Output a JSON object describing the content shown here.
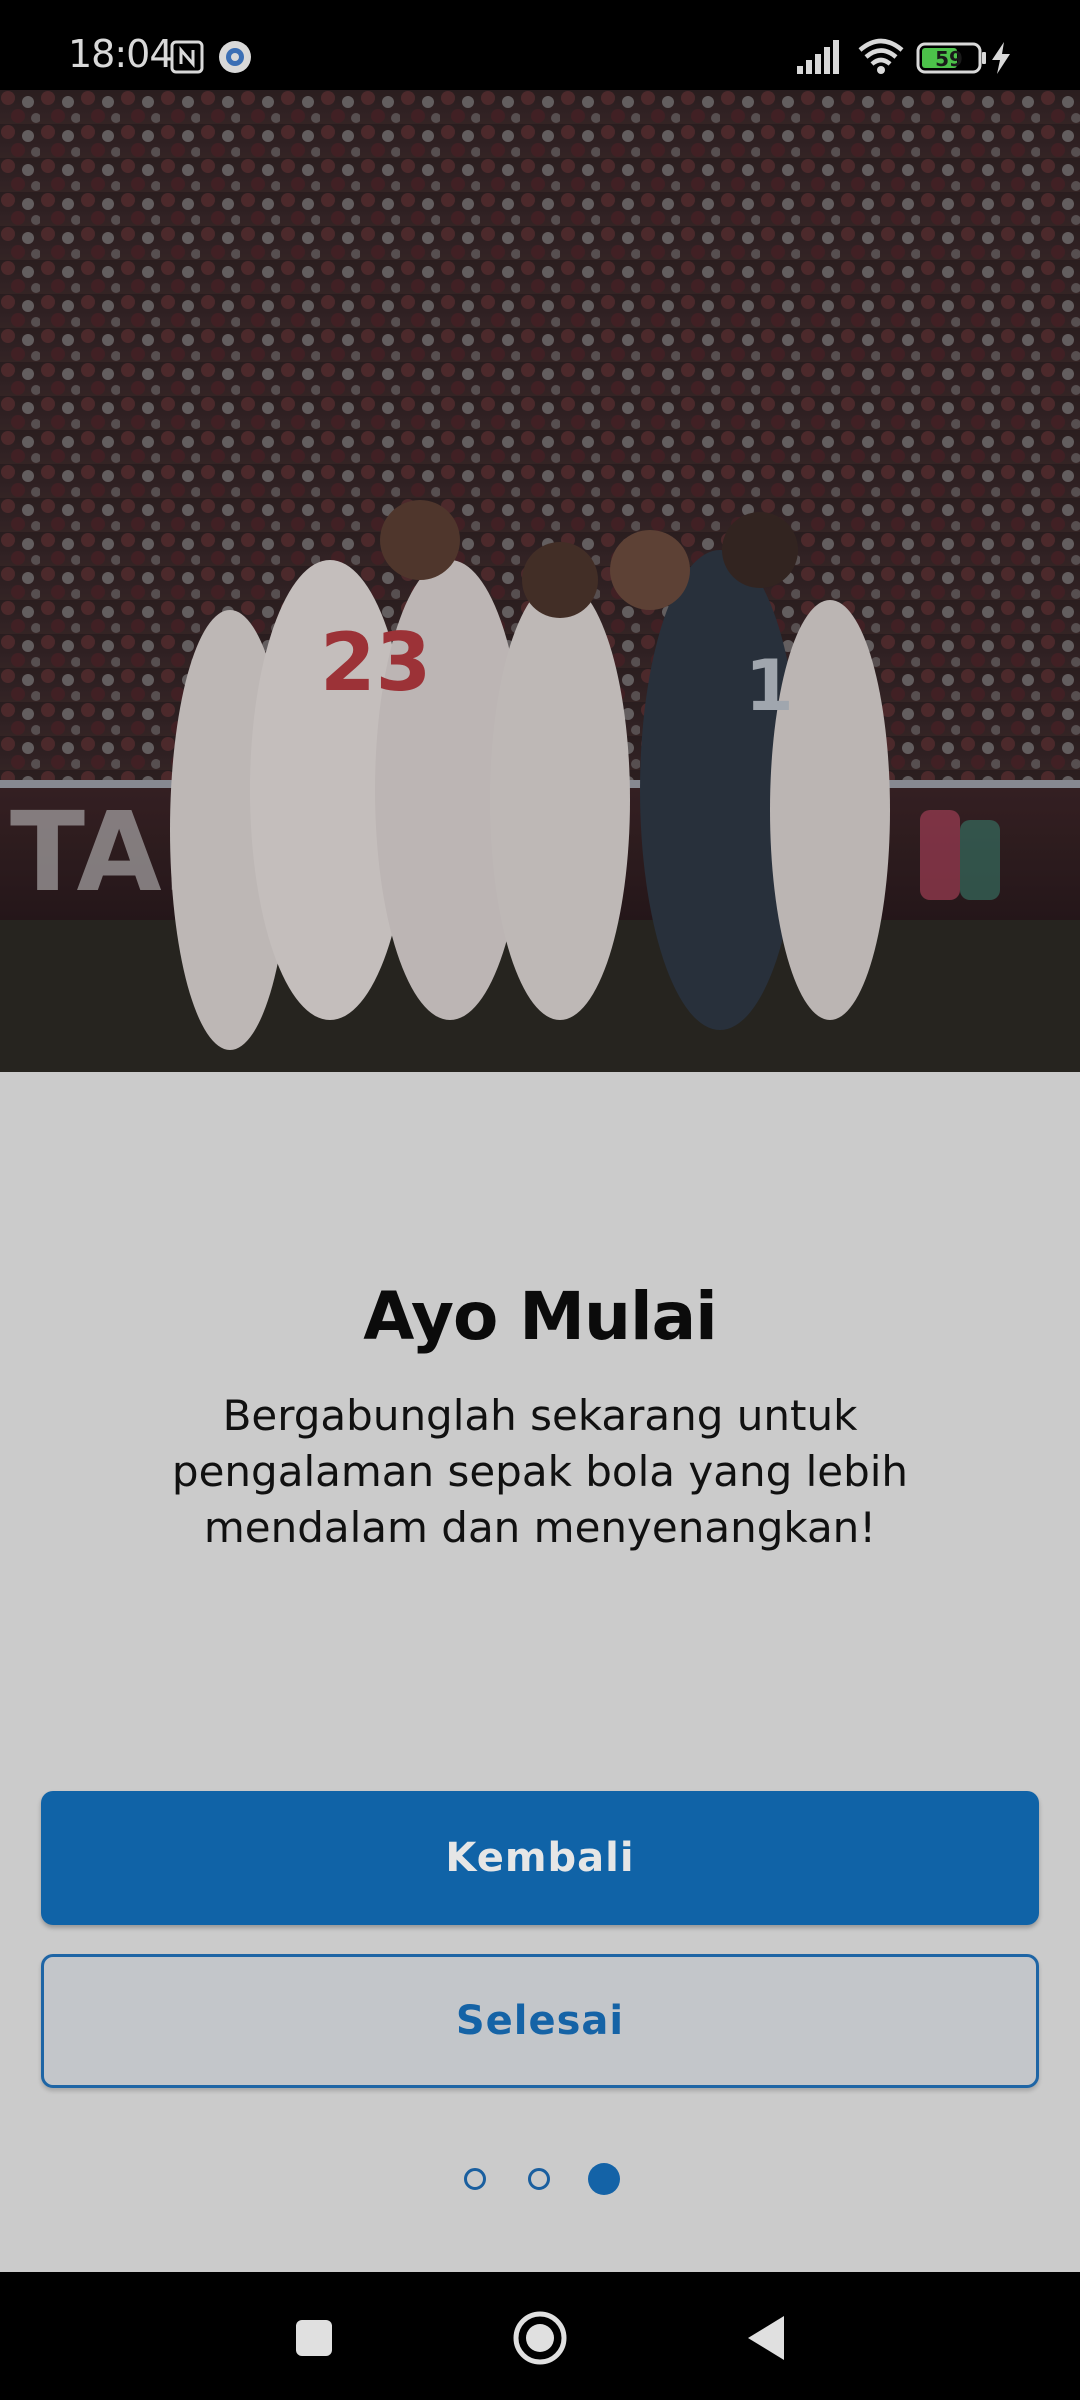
{
  "status_bar": {
    "time": "18:04",
    "battery_level": "59",
    "icons": [
      "nfc-icon",
      "app-notification-icon",
      "signal-icon",
      "wifi-icon",
      "battery-icon",
      "charging-icon"
    ]
  },
  "hero": {
    "image_subject": "team huddle photo"
  },
  "onboarding": {
    "title": "Ayo Mulai",
    "description": "Bergabunglah sekarang untuk pengalaman sepak bola yang lebih mendalam dan menyenangkan!",
    "back_label": "Kembali",
    "finish_label": "Selesai",
    "page_indicator": {
      "total": 3,
      "current": 3
    }
  },
  "navigation": {
    "icons": [
      "recents-icon",
      "home-icon",
      "back-icon"
    ]
  },
  "colors": {
    "primary": "#1063a7",
    "background": "#cbcbcb",
    "secondary_button_bg": "#c3c6ca"
  }
}
